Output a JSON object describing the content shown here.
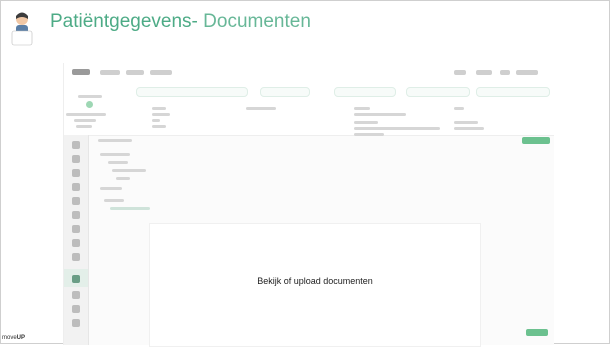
{
  "header": {
    "title_bold": "Patiëntgegevens-",
    "title_light": " Documenten"
  },
  "panel": {
    "message": "Bekijk of upload documenten"
  },
  "brand": {
    "prefix": "move",
    "suffix": "UP"
  },
  "colors": {
    "accent": "#4dab86",
    "button_green": "#6cc18f"
  },
  "icons": {
    "avatar": "doctor-avatar-icon"
  }
}
